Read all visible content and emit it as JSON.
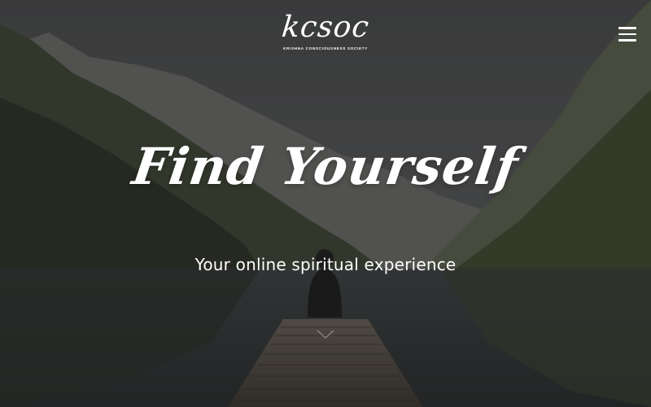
{
  "brand": {
    "logo_text": "kcsoc",
    "tagline": "KRISHNA CONSCIOUSNESS SOCIETY"
  },
  "header": {
    "menu_icon": "hamburger-menu-icon"
  },
  "hero": {
    "headline": "Find Yourself",
    "subtitle": "Your online spiritual experience",
    "background_image": "mountain-lake-with-person-on-dock",
    "scroll_icon": "chevron-down-icon"
  },
  "colors": {
    "text": "#ffffff",
    "overlay": "#1e1e1e",
    "water": "#3a3d3f",
    "forest": "#3c4a2e"
  }
}
